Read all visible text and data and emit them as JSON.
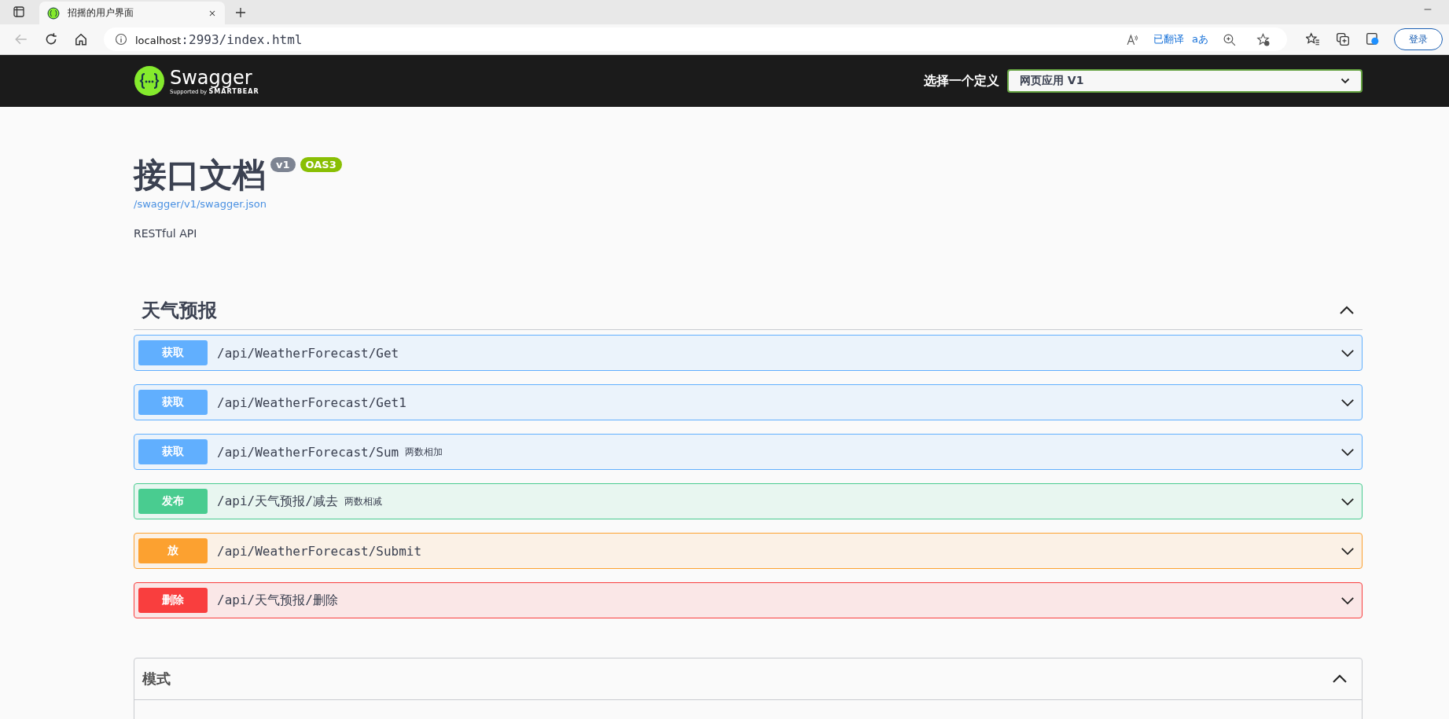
{
  "browser": {
    "tab": {
      "title": "招摇的用户界面"
    },
    "address": {
      "host": "localhost",
      "path": ":2993/index.html"
    },
    "translated_label": "已翻译",
    "translate_mark": "aあ",
    "sign_in": "登录"
  },
  "topbar": {
    "logo_text": "Swagger",
    "logo_sub": "Supported by",
    "logo_brand": "SMARTBEAR",
    "select_label": "选择一个定义",
    "select_value": "网页应用 V1"
  },
  "info": {
    "title": "接口文档",
    "version": "v1",
    "oas": "OAS3",
    "spec_link": "/swagger/v1/swagger.json",
    "description": "RESTful API"
  },
  "section": {
    "name": "天气预报",
    "expanded": true,
    "operations": [
      {
        "kind": "get",
        "method": "获取",
        "path": "/api/WeatherForecast/Get",
        "expanded": false
      },
      {
        "kind": "get",
        "method": "获取",
        "path": "/api/WeatherForecast/Get1",
        "expanded": false
      },
      {
        "kind": "get",
        "method": "获取",
        "path": "/api/WeatherForecast/Sum",
        "summary": "两数相加",
        "expanded": false
      },
      {
        "kind": "post",
        "method": "发布",
        "path": "/api/天气预报/减去",
        "summary": "两数相减",
        "expanded": false
      },
      {
        "kind": "put",
        "method": "放",
        "path": "/api/WeatherForecast/Submit",
        "expanded": false
      },
      {
        "kind": "delete",
        "method": "删除",
        "path": "/api/天气预报/删除",
        "expanded": false
      }
    ]
  },
  "schemas": {
    "title": "模式",
    "expanded": true
  }
}
